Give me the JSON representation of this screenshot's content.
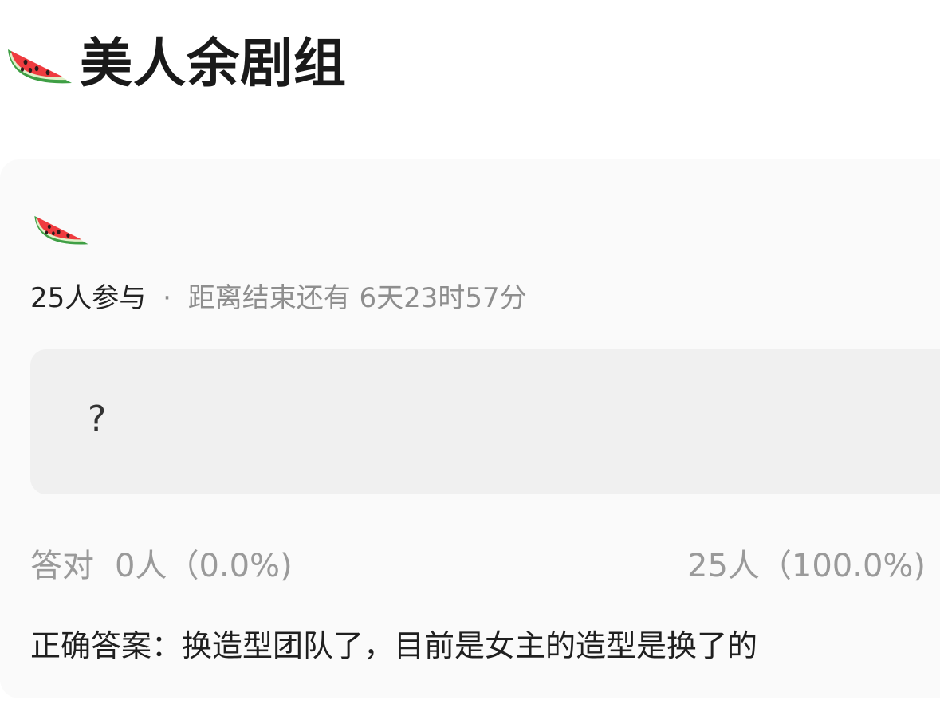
{
  "header": {
    "icon": "watermelon-icon",
    "title": "美人余剧组"
  },
  "poll": {
    "icon": "watermelon-icon",
    "participants": "25人参与",
    "separator": "·",
    "time_remaining": "距离结束还有 6天23时57分",
    "question": "?",
    "correct_label": "答对",
    "correct_stats": "0人（0.0%)",
    "other_stats": "25人（100.0%)",
    "answer_label": "正确答案：",
    "answer_text": "换造型团队了，目前是女主的造型是换了的"
  },
  "colors": {
    "background": "#ffffff",
    "card": "#fafafa",
    "question_box": "#f0f0f0",
    "muted_text": "#9a9a9a",
    "primary_text": "#1f1f1f"
  }
}
